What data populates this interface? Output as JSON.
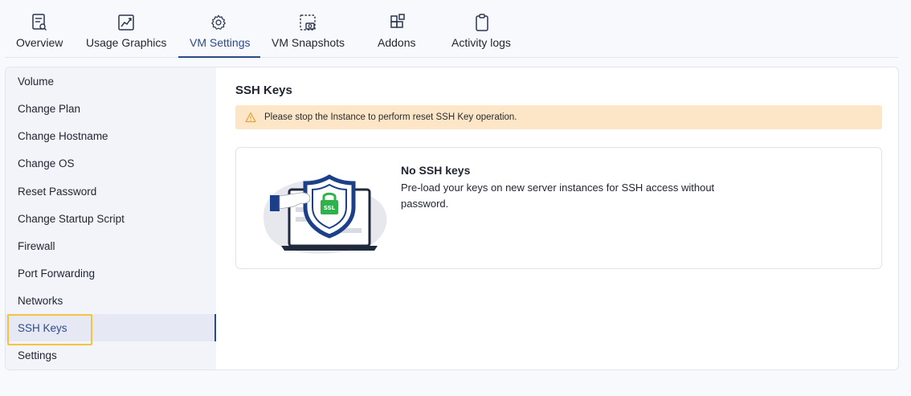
{
  "tabs": [
    {
      "label": "Overview",
      "icon": "report-search-icon"
    },
    {
      "label": "Usage Graphics",
      "icon": "chart-line-icon"
    },
    {
      "label": "VM Settings",
      "icon": "gear-icon",
      "active": true
    },
    {
      "label": "VM Snapshots",
      "icon": "camera-icon"
    },
    {
      "label": "Addons",
      "icon": "blocks-icon"
    },
    {
      "label": "Activity logs",
      "icon": "clipboard-icon"
    }
  ],
  "sidebar": {
    "items": [
      {
        "label": "Volume"
      },
      {
        "label": "Change Plan"
      },
      {
        "label": "Change Hostname"
      },
      {
        "label": "Change OS"
      },
      {
        "label": "Reset Password"
      },
      {
        "label": "Change Startup Script"
      },
      {
        "label": "Firewall"
      },
      {
        "label": "Port Forwarding"
      },
      {
        "label": "Networks"
      },
      {
        "label": "SSH Keys",
        "active": true
      },
      {
        "label": "Settings"
      }
    ]
  },
  "main": {
    "title": "SSH Keys",
    "alert": {
      "icon": "warning-icon",
      "text": "Please stop the Instance to perform reset SSH Key operation."
    },
    "empty_state": {
      "illustration": "ssl-shield-laptop-icon",
      "badge_text": "SSL",
      "title": "No SSH keys",
      "description": "Pre-load your keys on new server instances for SSH access without password."
    }
  },
  "colors": {
    "accent": "#2a4a8a",
    "alert_bg": "#fde6c8",
    "highlight": "#f5c242",
    "ssl_green": "#2fb24c"
  }
}
